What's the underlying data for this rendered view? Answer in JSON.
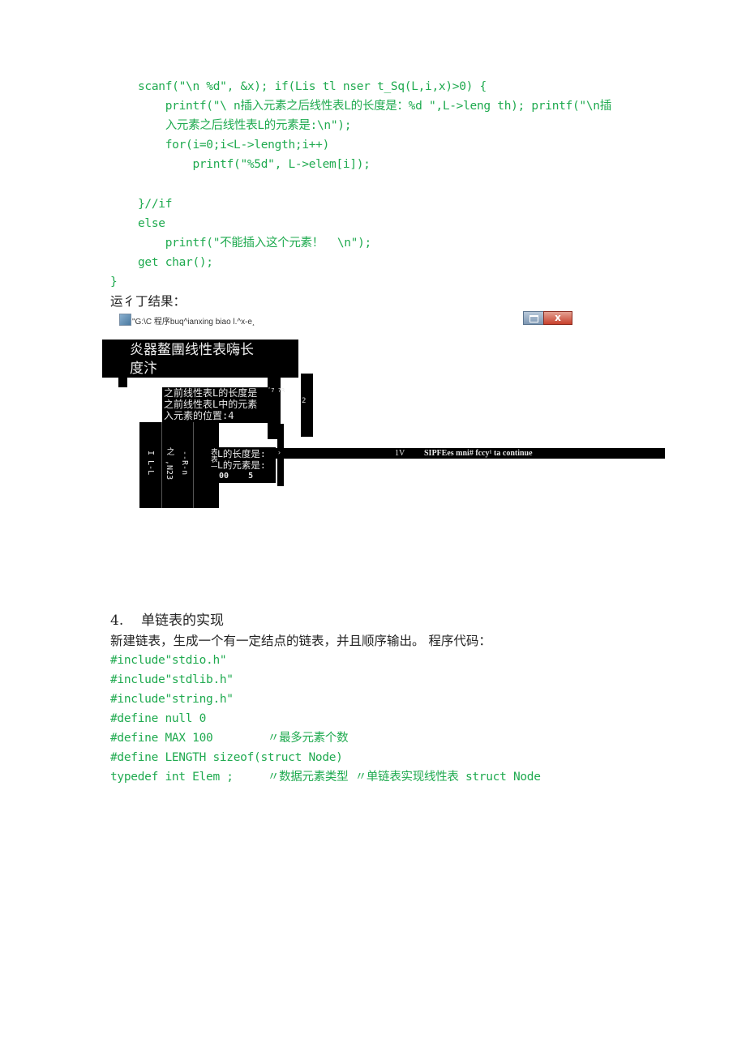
{
  "code_top": {
    "lines": [
      "scanf(\"\\n %d\", &x); if(Lis tl nser t_Sq(L,i,x)>0) {",
      "    printf(\"\\ n插入元素之后线性表L的长度是：%d \",L->leng th); printf(\"\\n插",
      "    入元素之后线性表L的元素是:\\n\");",
      "    for(i=0;i<L->length;i++)",
      "        printf(\"%5d\", L->elem[i]);",
      "",
      "}//if",
      "else",
      "    printf(\"不能插入这个元素！  \\n\");",
      "get char();"
    ],
    "closing_brace": "}"
  },
  "run_result_label": "运彳丁结果：",
  "console_window": {
    "title": "\"G:\\C 程序buq^ianxing biao l.^x-e¸",
    "maximize_icon": "maximize-icon",
    "close_icon": "close-icon",
    "close_label": "x",
    "header_line1": "炎器鳌團线性表嗨长",
    "header_line2": "度汴",
    "line_a": "之前线性表L的长度是",
    "line_a_suffix": "ˆ7 ?R",
    "line_b": "之前线性表L中的元素",
    "line_c": "入元素的位置:4",
    "side_digit": "2",
    "col1": "I L-L",
    "col2": "之 ,N23",
    "col3": "--R-n",
    "col4": "表表一",
    "line_d": "L的长度是:",
    "line_e": "L的元素是:",
    "line_f": "00    5",
    "footer_num": "1V",
    "footer_text": "SIPFEes mni# fccy¹ ta continue",
    "colon_mark": "›"
  },
  "section": {
    "heading_number": "4.",
    "heading_title": "单链表的实现",
    "description": "新建链表，生成一个有一定结点的链表，并且顺序输出。 程序代码：",
    "code_lines": [
      "#include\"stdio.h\"",
      "#include\"stdlib.h\"",
      "#include\"string.h\"",
      "#define null 0",
      "#define MAX 100        〃最多元素个数",
      "#define LENGTH sizeof(struct Node)",
      "typedef int Elem ;     〃数据元素类型 〃单链表实现线性表 struct Node"
    ]
  },
  "colors": {
    "code_green": "#1faa4f",
    "console_bg": "#000000",
    "console_fg": "#e8e8e8",
    "close_red": "#c8402c"
  }
}
